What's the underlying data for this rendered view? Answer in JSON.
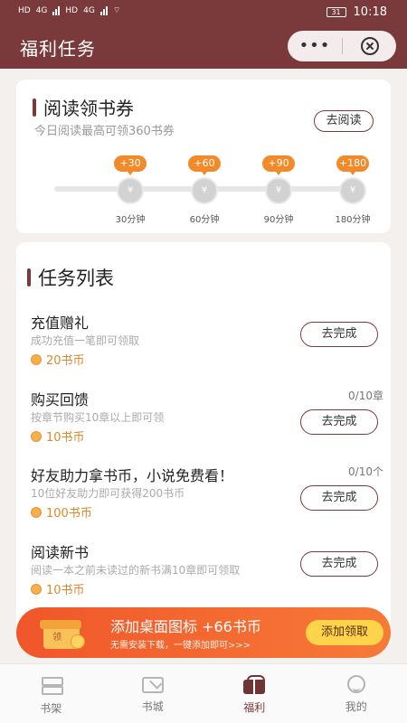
{
  "status_bar": {
    "left_labels": [
      "HD",
      "4G",
      "HD",
      "4G"
    ],
    "battery": "31",
    "time": "10:18"
  },
  "header": {
    "title": "福利任务",
    "more_label": "•••",
    "colors": {
      "brand": "#7a3a3c"
    }
  },
  "reading": {
    "title": "阅读领书券",
    "subtitle": "今日阅读最高可领360书券",
    "button": "去阅读",
    "coin_symbol": "¥",
    "milestones": [
      {
        "reward": "+30",
        "label": "30分钟"
      },
      {
        "reward": "+60",
        "label": "60分钟"
      },
      {
        "reward": "+90",
        "label": "90分钟"
      },
      {
        "reward": "+180",
        "label": "180分钟"
      }
    ]
  },
  "tasks": {
    "title": "任务列表",
    "items": [
      {
        "name": "充值赠礼",
        "desc": "成功充值一笔即可领取",
        "reward": "20书币",
        "progress": "",
        "button": "去完成"
      },
      {
        "name": "购买回馈",
        "desc": "按章节购买10章以上即可领",
        "reward": "10书币",
        "progress": "0/10章",
        "button": "去完成"
      },
      {
        "name": "好友助力拿书币，小说免费看！",
        "desc": "10位好友助力即可获得200书币",
        "reward": "100书币",
        "progress": "0/10个",
        "button": "去完成"
      },
      {
        "name": "阅读新书",
        "desc": "阅读一本之前未读过的新书满10章即可领取",
        "reward": "10书币",
        "progress": "",
        "button": "去完成"
      }
    ]
  },
  "banner": {
    "icon_text": "领",
    "title": "添加桌面图标 +66书币",
    "subtitle": "无需安装下载，一键添加即可>>>",
    "button": "添加领取"
  },
  "nav": {
    "active_index": 2,
    "items": [
      {
        "label": "书架",
        "icon": "bookshelf-icon"
      },
      {
        "label": "书城",
        "icon": "bookstore-icon"
      },
      {
        "label": "福利",
        "icon": "gift-icon"
      },
      {
        "label": "我的",
        "icon": "profile-icon"
      }
    ]
  }
}
